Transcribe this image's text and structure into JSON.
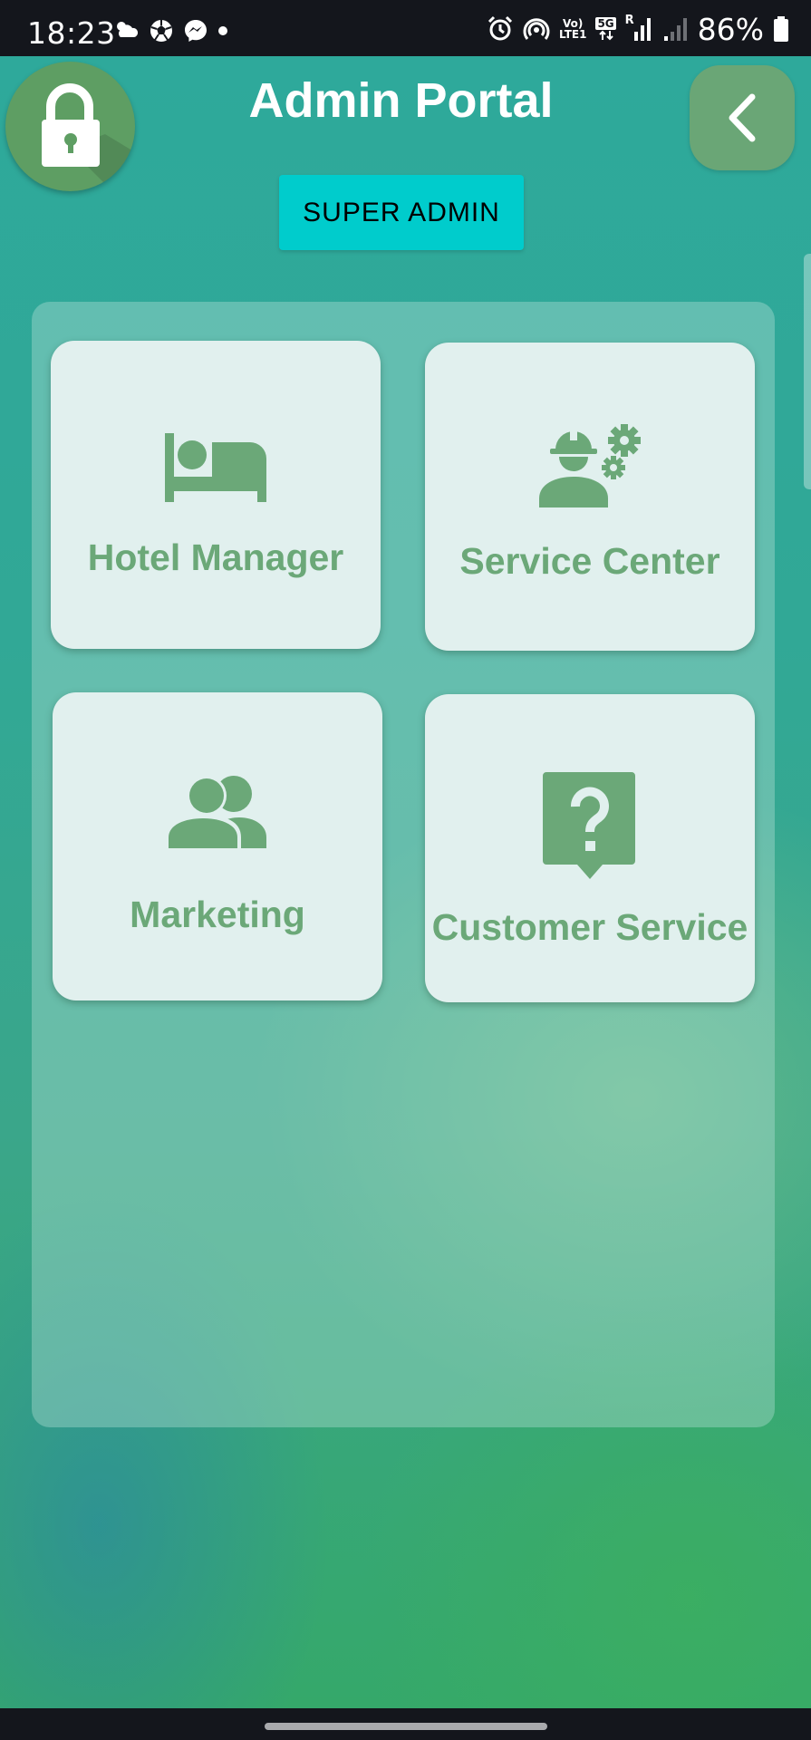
{
  "status_bar": {
    "time": "18:23",
    "left_icons": [
      "weather-icon",
      "soccer-ball-icon",
      "messenger-icon",
      "dot-icon"
    ],
    "right_icons": [
      "alarm-icon",
      "hotspot-icon",
      "volte-icon",
      "5g-icon",
      "signal-icon",
      "signal-weak-icon",
      "battery-icon"
    ],
    "volte_line1": "Vo)",
    "volte_line2": "LTE1",
    "network_label": "5G",
    "roaming_label": "R",
    "battery": "86%"
  },
  "header": {
    "title": "Admin Portal",
    "role_badge": "SUPER ADMIN",
    "lock_icon": "lock-icon",
    "back_icon": "chevron-left-icon"
  },
  "menu": {
    "items": [
      {
        "label": "Hotel Manager",
        "icon": "bed-icon"
      },
      {
        "label": "Service Center",
        "icon": "engineer-gears-icon"
      },
      {
        "label": "Marketing",
        "icon": "people-icon"
      },
      {
        "label": "Customer Service",
        "icon": "question-chat-icon"
      }
    ]
  },
  "colors": {
    "accent_green": "#6ba878",
    "card_background": "#e1f0ee",
    "badge_cyan": "#00cccc",
    "title_white": "#ffffff"
  }
}
